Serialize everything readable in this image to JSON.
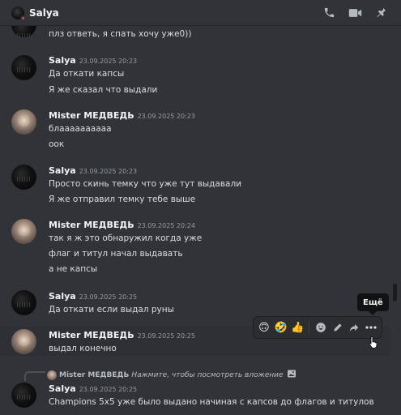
{
  "header": {
    "title": "Salya",
    "icons": [
      "phone-icon",
      "video-icon",
      "pin-icon"
    ]
  },
  "messages": [
    {
      "lines": [
        "плз ответь, я спать хочу уже0))"
      ]
    },
    {
      "author": "Salya",
      "time": "23.09.2025 20:23",
      "lines": [
        "Да откати капсы",
        "Я же сказал что выдали"
      ]
    },
    {
      "author": "Mister МЕДВЕДЬ",
      "time": "23.09.2025 20:23",
      "lines": [
        "блаааааааааа",
        "оок"
      ]
    },
    {
      "author": "Salya",
      "time": "23.09.2025 20:23",
      "lines": [
        "Просто скинь темку что уже тут выдавали",
        "Я же отправил темку тебе выше"
      ]
    },
    {
      "author": "Mister МЕДВЕДЬ",
      "time": "23.09.2025 20:24",
      "lines": [
        "так я ж это обнаружил когда уже",
        "флаг и титул начал выдавать",
        "а не капсы"
      ]
    },
    {
      "author": "Salya",
      "time": "23.09.2025 20:25",
      "lines": [
        "Да откати если выдал руны"
      ]
    },
    {
      "author": "Mister МЕДВЕДЬ",
      "time": "23.09.2025 20:25",
      "lines": [
        "выдал конечно"
      ]
    },
    {
      "author": "Salya",
      "time": "23.09.2025 20:25",
      "lines": [
        "Champions 5x5 уже было выдано начиная с капсов до флагов и титулов"
      ]
    }
  ],
  "reply": {
    "author": "Mister МЕДВЕДЬ",
    "text": "Нажмите, чтобы посмотреть вложение"
  },
  "hover_toolbar": {
    "reactions": [
      "🙃",
      "🤣",
      "👍"
    ],
    "tooltip": "Ещё"
  },
  "colors": {
    "background": "#313338",
    "text": "#dbdee1",
    "timestamp": "#949ba4",
    "status_dnd": "#f23f43"
  }
}
